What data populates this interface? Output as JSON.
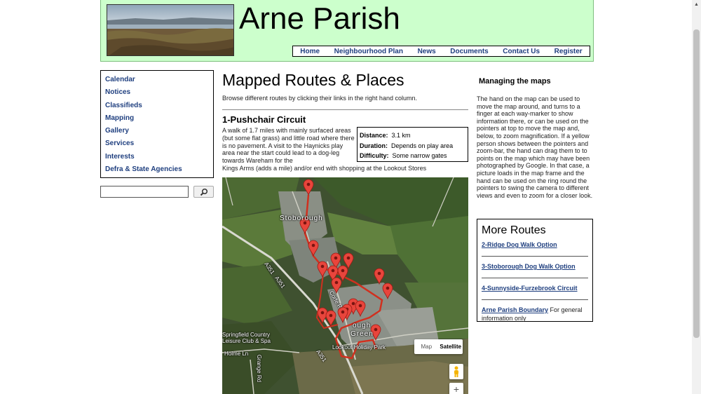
{
  "site": {
    "title": "Arne Parish",
    "nav": [
      "Home",
      "Neighbourhood Plan",
      "News",
      "Documents",
      "Contact Us",
      "Register"
    ]
  },
  "sidebar": {
    "items": [
      "Calendar",
      "Notices",
      "Classifieds",
      "Mapping",
      "Gallery",
      "Services",
      "Interests",
      "Defra & State Agencies"
    ],
    "search_icon": "magnifier-icon"
  },
  "main": {
    "title": "Mapped Routes & Places",
    "intro": "Browse different routes by clicking their links in the right hand column.",
    "route": {
      "title": "1-Pushchair Circuit",
      "description": "A walk of 1.7 miles with mainly surfaced areas (but some flat grass) and little road where there is no pavement. A visit to the Haynicks play area near the start could lead to a dog-leg towards Wareham for the",
      "description_cont": "Kings Arms (adds a mile) and/or end with shopping at the Lookout Stores",
      "facts": [
        {
          "label": "Distance:",
          "value": "3.1 km"
        },
        {
          "label": "Duration:",
          "value": "Depends on play area"
        },
        {
          "label": "Difficulty:",
          "value": "Some narrow gates"
        }
      ]
    },
    "map": {
      "labels": {
        "stoborough": "Stoborough",
        "a351_a": "A351",
        "a351_b": "A351",
        "a351_c": "A351",
        "springfield": "Springfield Country",
        "springfield2": "Leisure Club & Spa",
        "holme": "Holme Ln",
        "grange": "Grange Rd",
        "lookout": "Lookout Holiday Park",
        "green": "Green",
        "ough": "ough",
        "corfe": "Corfe R"
      },
      "type_map": "Map",
      "type_satellite": "Satellite",
      "zoom_in": "+",
      "marker_color": "#e8453c",
      "route_color": "#d0301f"
    }
  },
  "right": {
    "help_title": "Managing the maps",
    "help_text": "The hand on the map can be used to move the map around, and turns to a finger at each way-marker to show information there, or can be used on the pointers at top to move the map and, below, to zoom magnification. If a yellow person shows between the pointers and zoom-bar, the hand can drag them to to points on the map which may have been photographed by Google. In that case, a picture loads in the map frame and the hand can be used on the ring round the pointers to swing the camera to different views and even to zoom for a closer look.",
    "more_title": "More Routes",
    "links": [
      "2-Ridge Dog Walk Option",
      "3-Stoborough Dog Walk Option",
      "4-Sunnyside-Furzebrook Circuit"
    ],
    "last_link": "Arne Parish Boundary",
    "last_note": " For general information only"
  }
}
